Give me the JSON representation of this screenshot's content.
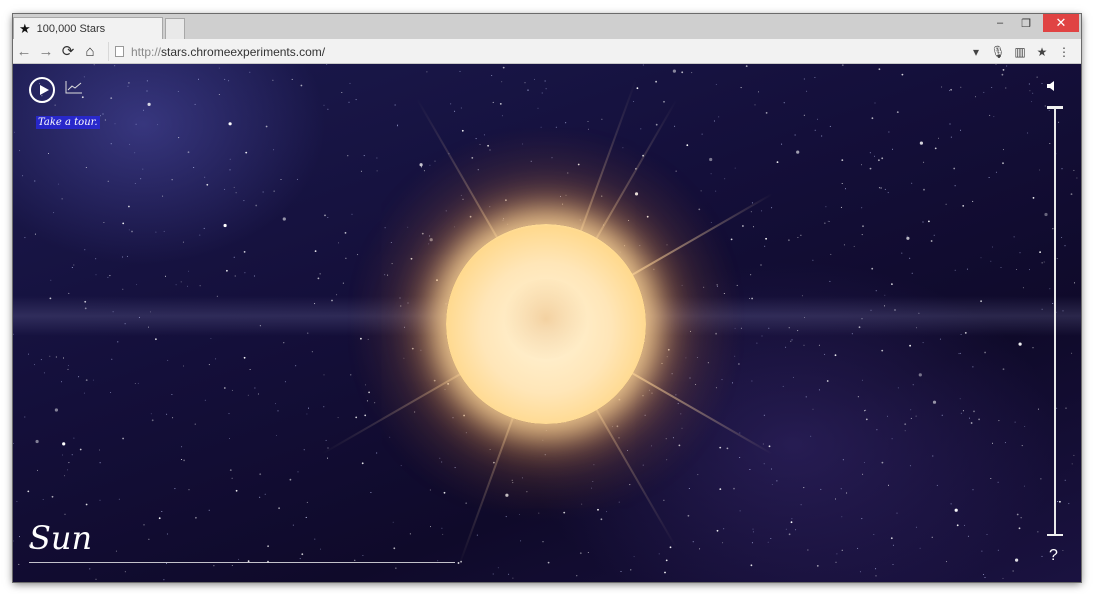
{
  "browser": {
    "tab_title": "100,000 Stars",
    "tab_icon": "star-icon",
    "url_protocol": "http://",
    "url_host": "stars.chromeexperiments.com/",
    "window_controls": [
      "minimize-icon",
      "maximize-icon",
      "close-icon"
    ],
    "nav_icons": [
      "back-icon",
      "forward-icon",
      "reload-icon",
      "home-icon"
    ],
    "right_icons": [
      "dropdown-icon",
      "microphone-icon",
      "bookmarks-icon",
      "bookmark-star-icon",
      "menu-icon"
    ]
  },
  "app": {
    "tour_label": "Take a tour.",
    "current_object": "Sun",
    "help_label": "?",
    "colors": {
      "space_dark": "#140f3a",
      "tour_highlight": "#2828dc",
      "sun": "#fff4d8"
    }
  }
}
